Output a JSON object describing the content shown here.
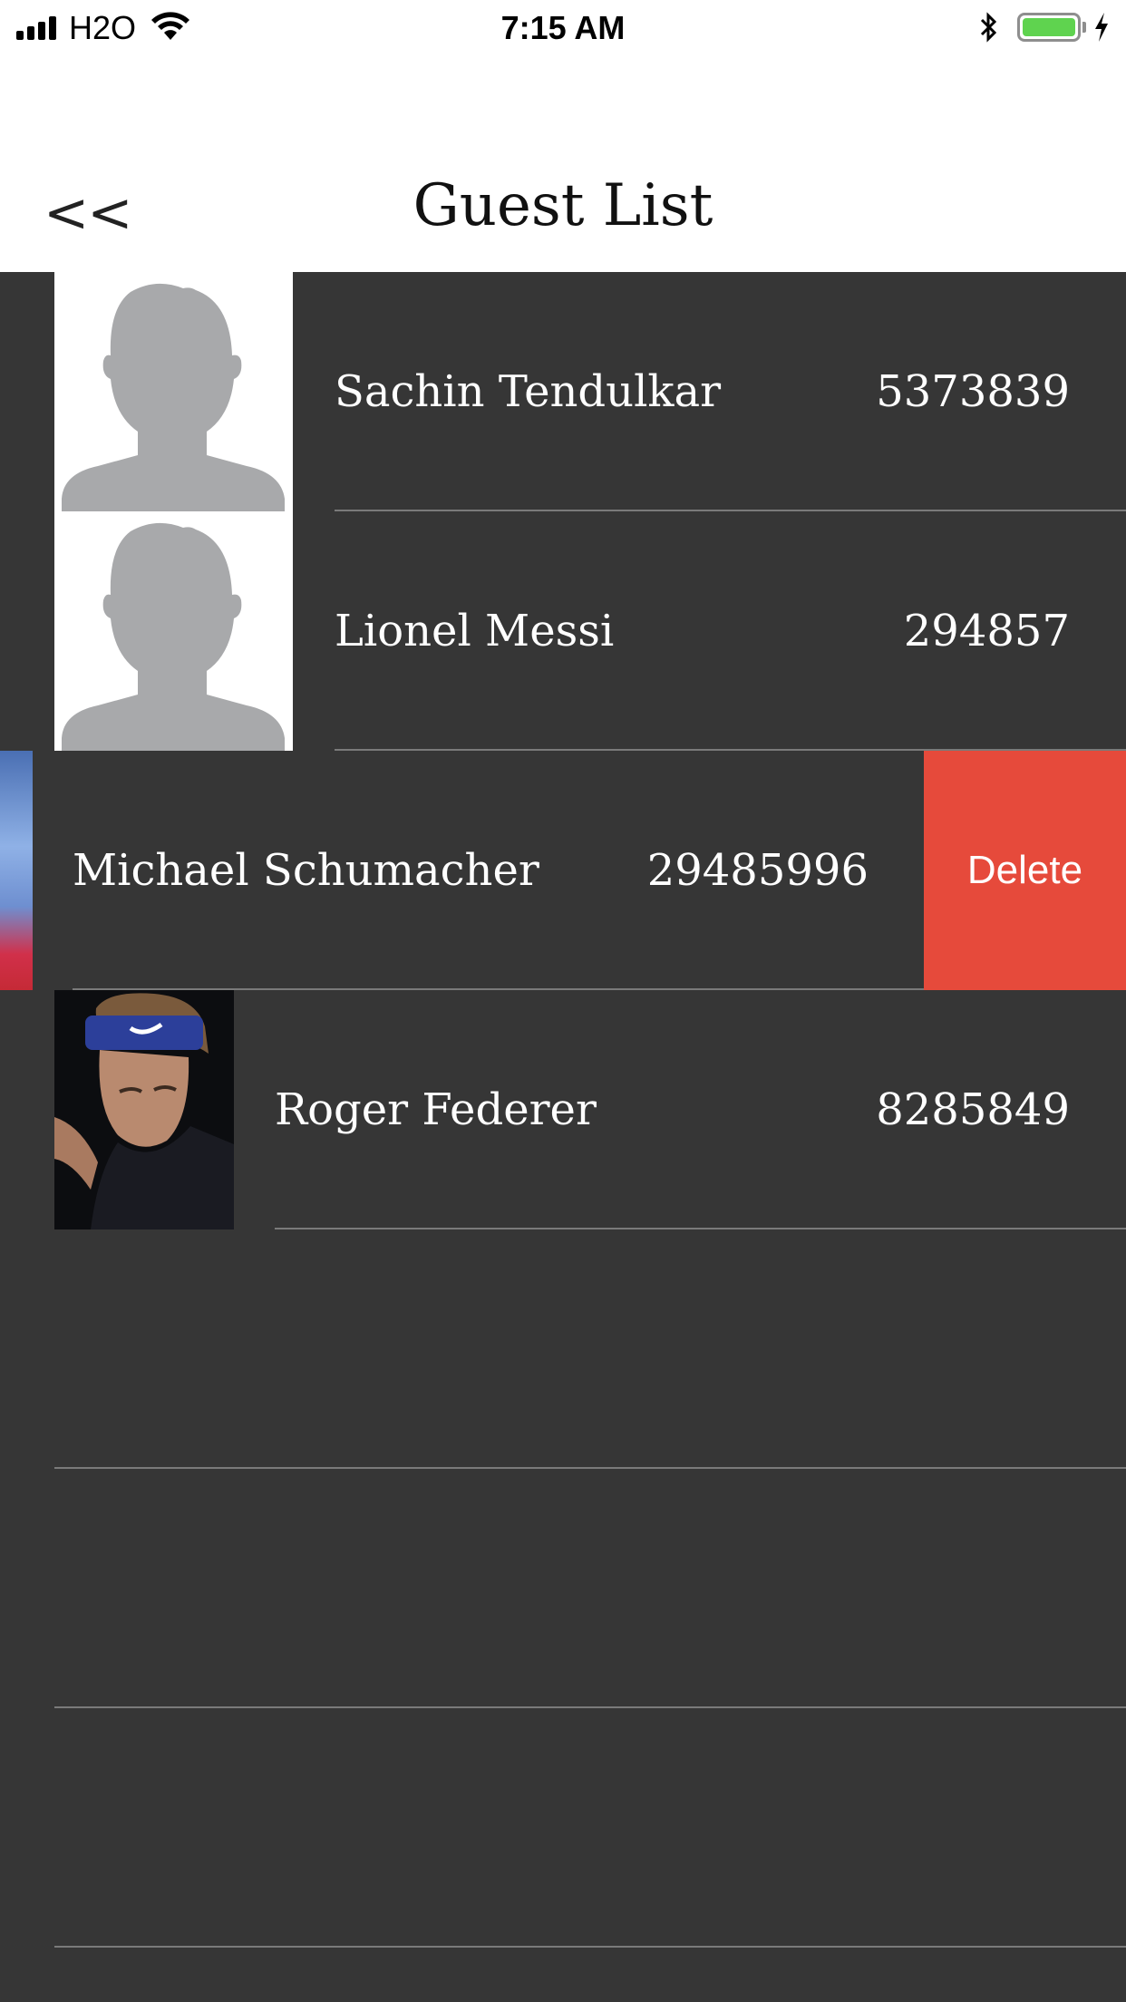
{
  "status_bar": {
    "carrier": "H2O",
    "time": "7:15 AM",
    "battery_level": 1.0,
    "charging": true
  },
  "nav": {
    "back_label": "<<",
    "title": "Guest List"
  },
  "guests": [
    {
      "name": "Sachin Tendulkar",
      "phone": "5373839",
      "avatar": "person-placeholder-icon"
    },
    {
      "name": "Lionel Messi",
      "phone": "294857",
      "avatar": "person-placeholder-icon"
    },
    {
      "name": "Michael Schumacher",
      "phone": "29485996",
      "avatar": "photo",
      "swiped": true
    },
    {
      "name": "Roger Federer",
      "phone": "8285849",
      "avatar": "photo"
    }
  ],
  "row_actions": {
    "delete_label": "Delete"
  },
  "colors": {
    "list_background": "#363636",
    "delete": "#e64a3b",
    "separator": "#7a7a7a"
  }
}
